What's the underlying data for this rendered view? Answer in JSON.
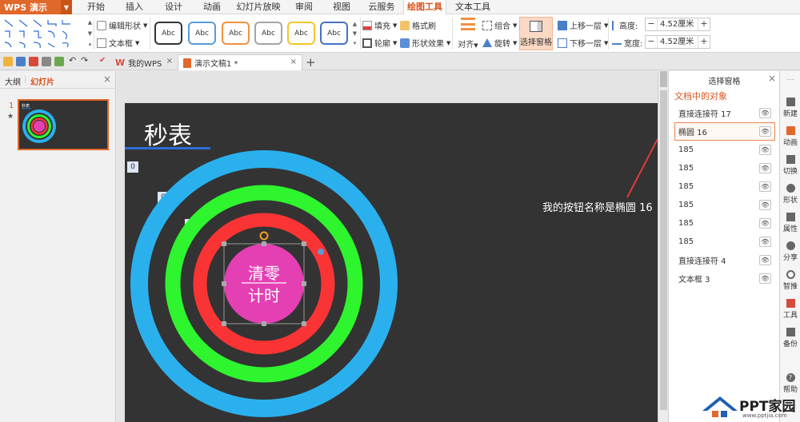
{
  "app": {
    "name": "WPS 演示"
  },
  "menu": {
    "items": [
      "开始",
      "插入",
      "设计",
      "动画",
      "幻灯片放映",
      "审阅",
      "视图",
      "云服务",
      "绘图工具",
      "文本工具"
    ],
    "active": "绘图工具"
  },
  "ribbon": {
    "edit_shape": "编辑形状",
    "textbox": "文本框",
    "style_label": "Abc",
    "fill": "填充",
    "format_brush": "格式刷",
    "outline": "轮廓",
    "shape_effects": "形状效果",
    "align": "对齐",
    "group": "组合",
    "rotate": "旋转",
    "selection_pane": "选择窗格",
    "bring_forward": "上移一层",
    "send_backward": "下移一层",
    "height_label": "高度:",
    "height_value": "4.52厘米",
    "width_label": "宽度:",
    "width_value": "4.52厘米"
  },
  "tabs": {
    "my_wps": "我的WPS",
    "document": "演示文稿1 *"
  },
  "left_panel": {
    "tab_outline": "大纲",
    "tab_slides": "幻灯片",
    "slide_number": "1",
    "thumb_star": "★"
  },
  "slide": {
    "title": "秒表",
    "counters": [
      "0",
      "0",
      "0"
    ],
    "button_text_line1": "清零",
    "button_text_line2": "计时",
    "annotation": "我的按钮名称是椭圆 16"
  },
  "selection_pane": {
    "title": "选择窗格",
    "section": "文档中的对象",
    "items": [
      {
        "name": "直接连接符 17",
        "selected": false
      },
      {
        "name": "椭圆 16",
        "selected": true
      },
      {
        "name": "185",
        "selected": false
      },
      {
        "name": "185",
        "selected": false
      },
      {
        "name": "185",
        "selected": false
      },
      {
        "name": "185",
        "selected": false
      },
      {
        "name": "185",
        "selected": false
      },
      {
        "name": "185",
        "selected": false
      },
      {
        "name": "直接连接符 4",
        "selected": false
      },
      {
        "name": "文本框 3",
        "selected": false
      }
    ]
  },
  "right_sidebar": {
    "top": "...",
    "items": [
      "新建",
      "动画",
      "切换",
      "形状",
      "属性",
      "分享",
      "智推",
      "工具",
      "备份",
      "帮助"
    ]
  },
  "watermark": {
    "text": "PPT家园",
    "url": "www.pptjia.com"
  },
  "colors": {
    "accent": "#d9541e",
    "slide_bg": "#333333",
    "ring_blue": "#2bb0ee",
    "ring_green": "#2ef52e",
    "ring_red": "#fa3434",
    "button_pink": "#e53fb4"
  }
}
